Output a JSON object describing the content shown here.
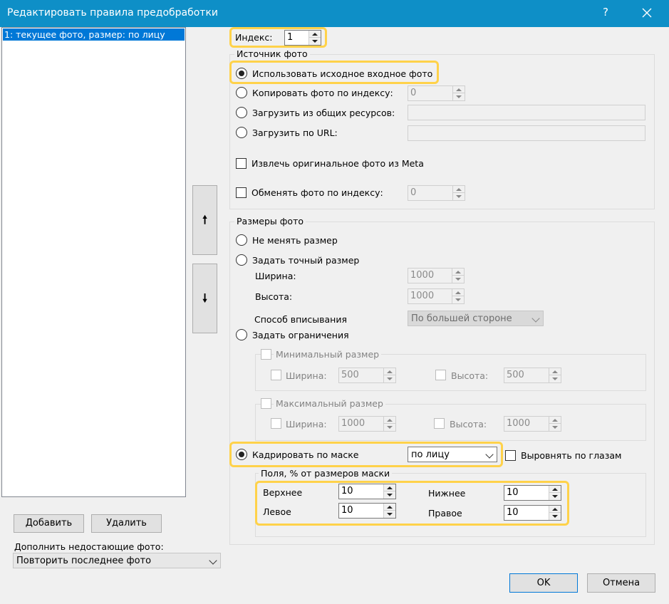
{
  "window": {
    "title": "Редактировать правила предобработки",
    "help": "?",
    "close_icon": "close-icon"
  },
  "rules_list": {
    "items": [
      "1: текущее фото, размер: по лицу"
    ]
  },
  "move_buttons": {
    "up": "🠕",
    "down": "🠗"
  },
  "index": {
    "label": "Индекс:",
    "value": "1"
  },
  "source": {
    "title": "Источник фото",
    "use_input": "Использовать исходное входное фото",
    "copy_by_index": "Копировать фото по индексу:",
    "copy_index_value": "0",
    "load_shared": "Загрузить из общих ресурсов:",
    "load_url": "Загрузить по URL:",
    "extract_meta": "Извлечь оригинальное фото из Meta",
    "swap_by_index": "Обменять фото по индексу:",
    "swap_index_value": "0"
  },
  "size": {
    "title": "Размеры фото",
    "no_resize": "Не менять размер",
    "exact_size": "Задать точный размер",
    "width_label": "Ширина:",
    "width_value": "1000",
    "height_label": "Высота:",
    "height_value": "1000",
    "fit_label": "Способ вписывания",
    "fit_value": "По большей стороне",
    "constraints": "Задать ограничения",
    "min_title": "Минимальный размер",
    "min_width_label": "Ширина:",
    "min_width_value": "500",
    "min_height_label": "Высота:",
    "min_height_value": "500",
    "max_title": "Максимальный размер",
    "max_width_label": "Ширина:",
    "max_width_value": "1000",
    "max_height_label": "Высота:",
    "max_height_value": "1000",
    "crop_mask": "Кадрировать по маске",
    "crop_mask_value": "по лицу",
    "align_eyes": "Выровнять по глазам",
    "margins_title": "Поля, % от размеров маски",
    "top_label": "Верхнее",
    "top_value": "10",
    "bottom_label": "Нижнее",
    "bottom_value": "10",
    "left_label": "Левое",
    "left_value": "10",
    "right_label": "Правое",
    "right_value": "10"
  },
  "bottom_left": {
    "add": "Добавить",
    "delete": "Удалить",
    "fill_label": "Дополнить недостающие фото:",
    "fill_value": "Повторить последнее фото"
  },
  "dialog_buttons": {
    "ok": "OK",
    "cancel": "Отмена"
  },
  "colors": {
    "titlebar": "#0e8fc7",
    "selection": "#0078d7",
    "highlight": "#ffd24a"
  }
}
